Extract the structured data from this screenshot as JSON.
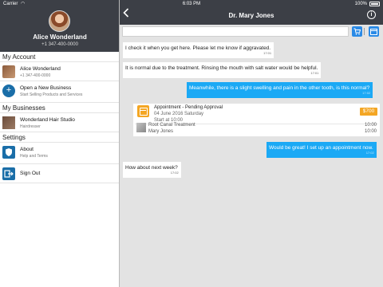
{
  "status_bar": {
    "carrier": "Carrier",
    "time": "6:03 PM",
    "battery": "100%"
  },
  "sidebar": {
    "profile": {
      "name": "Alice Wonderland",
      "phone": "+1 347-400-0000"
    },
    "sections": {
      "my_account": "My Account",
      "my_businesses": "My Businesses",
      "settings": "Settings"
    },
    "account_item": {
      "title": "Alice Wonderland",
      "subtitle": "+1 347-400-0000"
    },
    "open_business": {
      "title": "Open a New Business",
      "subtitle": "Start Selling Products and Services"
    },
    "business_item": {
      "title": "Wonderland Hair Studio",
      "subtitle": "Hairdresser"
    },
    "about": {
      "title": "About",
      "subtitle": "Help and Terms"
    },
    "sign_out": {
      "title": "Sign Out"
    }
  },
  "chat": {
    "title": "Dr. Mary Jones",
    "input_placeholder": "",
    "messages": [
      {
        "text": "I check it when you get here. Please let me know if aggravated.",
        "time": "17:01"
      },
      {
        "text": "It is normal due to the treatment. Rinsing the mouth with salt water would be helpful.",
        "time": "17:01"
      },
      {
        "text": "Meanwhile, there is a slight swelling and pain in the other tooth, is this normal?",
        "time": "17:02"
      },
      {
        "text": "Would be great! I set up an appointment now.",
        "time": "17:02"
      },
      {
        "text": "How about next week?",
        "time": "17:02"
      }
    ],
    "appointment": {
      "title": "Appointment - Pending Approval",
      "date": "04 June 2016 Saturday",
      "start": "Start at 10:00",
      "price": "$700",
      "service": "Root Canal Treatment",
      "doctor": "Mary Jones",
      "time1": "10:00",
      "time2": "10:00"
    }
  },
  "colors": {
    "header_bg": "#3c3f46",
    "accent_blue": "#1ba9f5",
    "button_blue": "#2a8ae6",
    "appointment_orange": "#f4a623",
    "chat_bg": "#e3e3e3"
  }
}
